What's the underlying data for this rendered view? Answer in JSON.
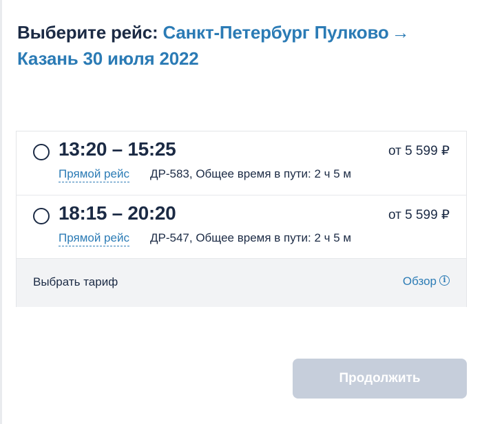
{
  "header": {
    "prefix": "Выберите рейс:",
    "route": "Санкт-Петербург Пулково",
    "arrow": "→",
    "destination": "Казань 30 июля 2022"
  },
  "flights": [
    {
      "time": "13:20 – 15:25",
      "price": "от 5 599 ₽",
      "type": "Прямой рейс",
      "details": "ДР-583, Общее время в пути: 2 ч 5 м",
      "selected": false
    },
    {
      "time": "18:15 – 20:20",
      "price": "от 5 599 ₽",
      "type": "Прямой рейс",
      "details": "ДР-547, Общее время в пути: 2 ч 5 м",
      "selected": false
    }
  ],
  "tariff": {
    "label": "Выбрать тариф",
    "overview": "Обзор",
    "overview_icon": "info-icon"
  },
  "actions": {
    "continue_label": "Продолжить",
    "continue_enabled": false
  },
  "colors": {
    "accent": "#2b7bb5",
    "text": "#1b2a44",
    "button_disabled": "#c6cedb"
  }
}
